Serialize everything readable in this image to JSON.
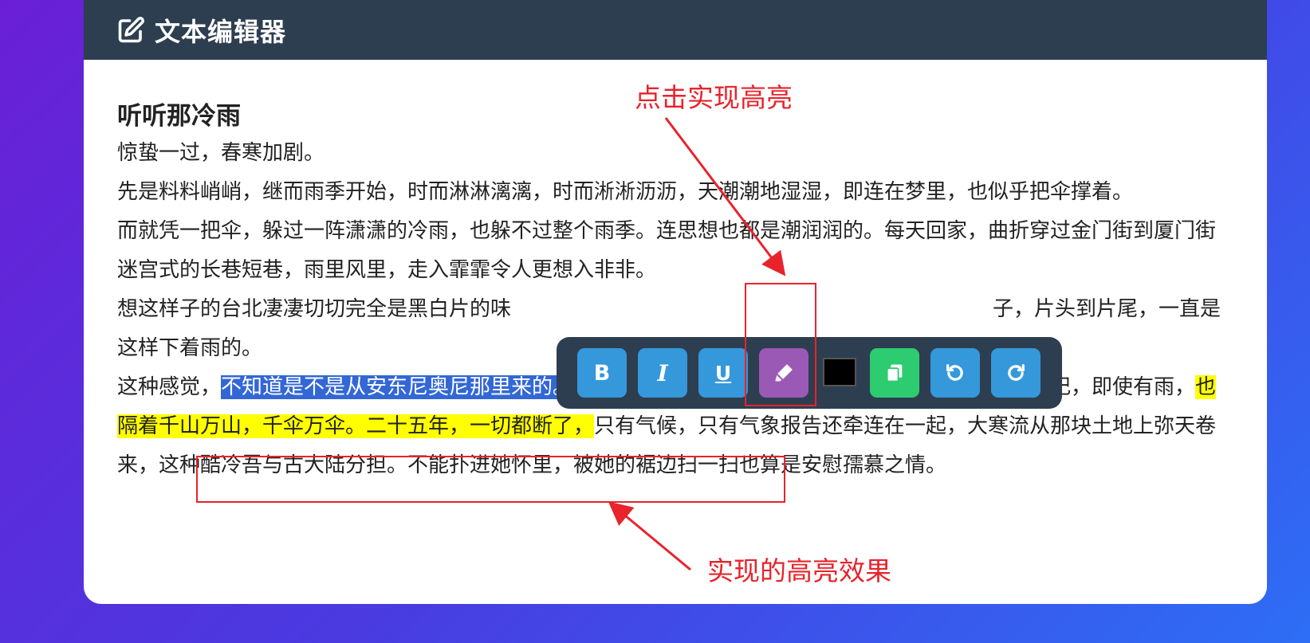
{
  "header": {
    "title": "文本编辑器",
    "icon": "edit-icon"
  },
  "article": {
    "title": "听听那冷雨",
    "p1": "惊蛰一过，春寒加剧。",
    "p2": "先是料料峭峭，继而雨季开始，时而淋淋漓漓，时而淅淅沥沥，天潮潮地湿湿，即连在梦里，也似乎把伞撑着。",
    "p3": "而就凭一把伞，躲过一阵潇潇的冷雨，也躲不过整个雨季。连思想也都是潮润润的。每天回家，曲折穿过金门街到厦门街迷宫式的长巷短巷，雨里风里，走入霏霏令人更想入非非。",
    "p4_start": "想这样子的台北凄凄切切完全是黑白片的味",
    "p4_end": "子，片头到片尾，一直是这样下着雨的。",
    "p5_before": "这种感觉，",
    "p5_selected": "不知道是不是从安东尼奥尼那里来的。不过那一块土地是久违了",
    "p5_mid": "，二十五年，四分之一的世纪，即使有雨，",
    "p5_highlight": "也隔着千山万山，千伞万伞。二十五年，一切都断了，",
    "p5_after": "只有气候，只有气象报告还牵连在一起，大寒流从那块土地上弥天卷来，这种酷冷吾与古大陆分担。不能扑进她怀里，被她的裾边扫一扫也算是安慰孺慕之情。"
  },
  "toolbar": {
    "bold_label": "B",
    "italic_label": "I",
    "underline_label": "U",
    "highlight_icon": "highlighter-icon",
    "text_color": "#000000",
    "copy_icon": "copy-icon",
    "undo_icon": "undo-icon",
    "redo_icon": "redo-icon"
  },
  "annotations": {
    "top_note": "点击实现高亮",
    "bottom_note": "实现的高亮效果"
  },
  "colors": {
    "header_bg": "#2d3e50",
    "selection": "#3367d6",
    "highlight": "#ffff00",
    "annotation": "#e8232b",
    "button_blue": "#3498db",
    "button_purple": "#9b59b6",
    "button_green": "#2ecc71"
  }
}
